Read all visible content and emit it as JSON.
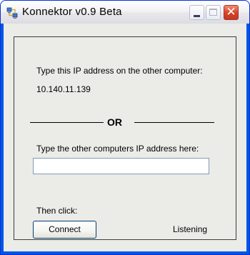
{
  "window": {
    "title": "Konnektor v0.9 Beta",
    "icons": {
      "app": "network-app-icon",
      "minimize": "minimize-icon",
      "maximize": "maximize-icon",
      "close": "close-icon"
    },
    "close_glyph": "✕"
  },
  "main": {
    "ip_prompt": "Type this IP address on the other computer:",
    "ip_address": "10.140.11.139",
    "or_label": "OR",
    "remote_prompt": "Type the other computers IP address here:",
    "remote_ip": {
      "value": "",
      "placeholder": ""
    },
    "then_click_label": "Then click:",
    "connect_label": "Connect",
    "status": "Listening"
  },
  "colors": {
    "titlebar_text": "#000000",
    "client_bg": "#ebebe8",
    "border": "#3c3c3c",
    "input_border": "#7f9db9",
    "close_red": "#d64026"
  }
}
